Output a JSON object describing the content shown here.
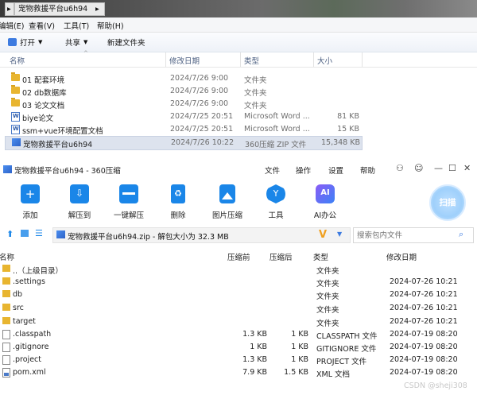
{
  "explorer": {
    "address": [
      "宠物救援平台u6h94"
    ],
    "menu": [
      "编辑(E)",
      "查看(V)",
      "工具(T)",
      "帮助(H)"
    ],
    "toolbar": {
      "open": "打开",
      "share": "共享",
      "new_folder": "新建文件夹"
    },
    "columns": {
      "name": "名称",
      "date": "修改日期",
      "type": "类型",
      "size": "大小"
    },
    "rows": [
      {
        "name": "01 配套环境",
        "date": "2024/7/26 9:00",
        "type": "文件夹",
        "size": "",
        "icon": "folder-icon"
      },
      {
        "name": "02 db数据库",
        "date": "2024/7/26 9:00",
        "type": "文件夹",
        "size": "",
        "icon": "folder-icon"
      },
      {
        "name": "03 论文文档",
        "date": "2024/7/26 9:00",
        "type": "文件夹",
        "size": "",
        "icon": "folder-icon"
      },
      {
        "name": "biye论文",
        "date": "2024/7/25 20:51",
        "type": "Microsoft Word ...",
        "size": "81 KB",
        "icon": "word-doc-icon"
      },
      {
        "name": "ssm+vue环境配置文档",
        "date": "2024/7/25 20:51",
        "type": "Microsoft Word ...",
        "size": "15 KB",
        "icon": "word-doc-icon"
      },
      {
        "name": "宠物救援平台u6h94",
        "date": "2024/7/26 10:22",
        "type": "360压缩 ZIP 文件",
        "size": "15,348 KB",
        "icon": "zip-icon"
      }
    ]
  },
  "zipwin": {
    "title": "宠物救援平台u6h94 - 360压缩",
    "menu": [
      "文件",
      "操作",
      "设置",
      "帮助"
    ],
    "ribbon": [
      {
        "label": "添加",
        "icon": "add-icon",
        "color": "#1a86e8"
      },
      {
        "label": "解压到",
        "icon": "extract-to-icon",
        "color": "#1a86e8"
      },
      {
        "label": "一键解压",
        "icon": "one-click-extract-icon",
        "color": "#1a86e8"
      },
      {
        "label": "删除",
        "icon": "delete-icon",
        "color": "#1a86e8"
      },
      {
        "label": "图片压缩",
        "icon": "image-compress-icon",
        "color": "#1a86e8"
      },
      {
        "label": "工具",
        "icon": "tools-icon",
        "color": "#1a86e8"
      },
      {
        "label": "AI办公",
        "icon": "ai-office-icon",
        "color": "#1a86e8"
      }
    ],
    "scan_label": "扫描",
    "path": "宠物救援平台u6h94.zip - 解包大小为 32.3 MB",
    "search_placeholder": "搜索包内文件",
    "columns": {
      "name": "名称",
      "packed": "压缩前",
      "unpacked": "压缩后",
      "type": "类型",
      "date": "修改日期"
    },
    "rows": [
      {
        "name": "..（上级目录）",
        "packed": "",
        "unpacked": "",
        "type": "文件夹",
        "date": "",
        "icon": "folder-icon"
      },
      {
        "name": ".settings",
        "packed": "",
        "unpacked": "",
        "type": "文件夹",
        "date": "2024-07-26 10:21",
        "icon": "folder-icon"
      },
      {
        "name": "db",
        "packed": "",
        "unpacked": "",
        "type": "文件夹",
        "date": "2024-07-26 10:21",
        "icon": "folder-icon"
      },
      {
        "name": "src",
        "packed": "",
        "unpacked": "",
        "type": "文件夹",
        "date": "2024-07-26 10:21",
        "icon": "folder-icon"
      },
      {
        "name": "target",
        "packed": "",
        "unpacked": "",
        "type": "文件夹",
        "date": "2024-07-26 10:21",
        "icon": "folder-icon"
      },
      {
        "name": ".classpath",
        "packed": "1.3 KB",
        "unpacked": "1 KB",
        "type": "CLASSPATH 文件",
        "date": "2024-07-19 08:20",
        "icon": "file-icon"
      },
      {
        "name": ".gitignore",
        "packed": "1 KB",
        "unpacked": "1 KB",
        "type": "GITIGNORE 文件",
        "date": "2024-07-19 08:20",
        "icon": "file-icon"
      },
      {
        "name": ".project",
        "packed": "1.3 KB",
        "unpacked": "1 KB",
        "type": "PROJECT 文件",
        "date": "2024-07-19 08:20",
        "icon": "file-icon"
      },
      {
        "name": "pom.xml",
        "packed": "7.9 KB",
        "unpacked": "1.5 KB",
        "type": "XML 文档",
        "date": "2024-07-19 08:20",
        "icon": "xml-file-icon"
      }
    ]
  },
  "watermark": "CSDN @sheji308"
}
